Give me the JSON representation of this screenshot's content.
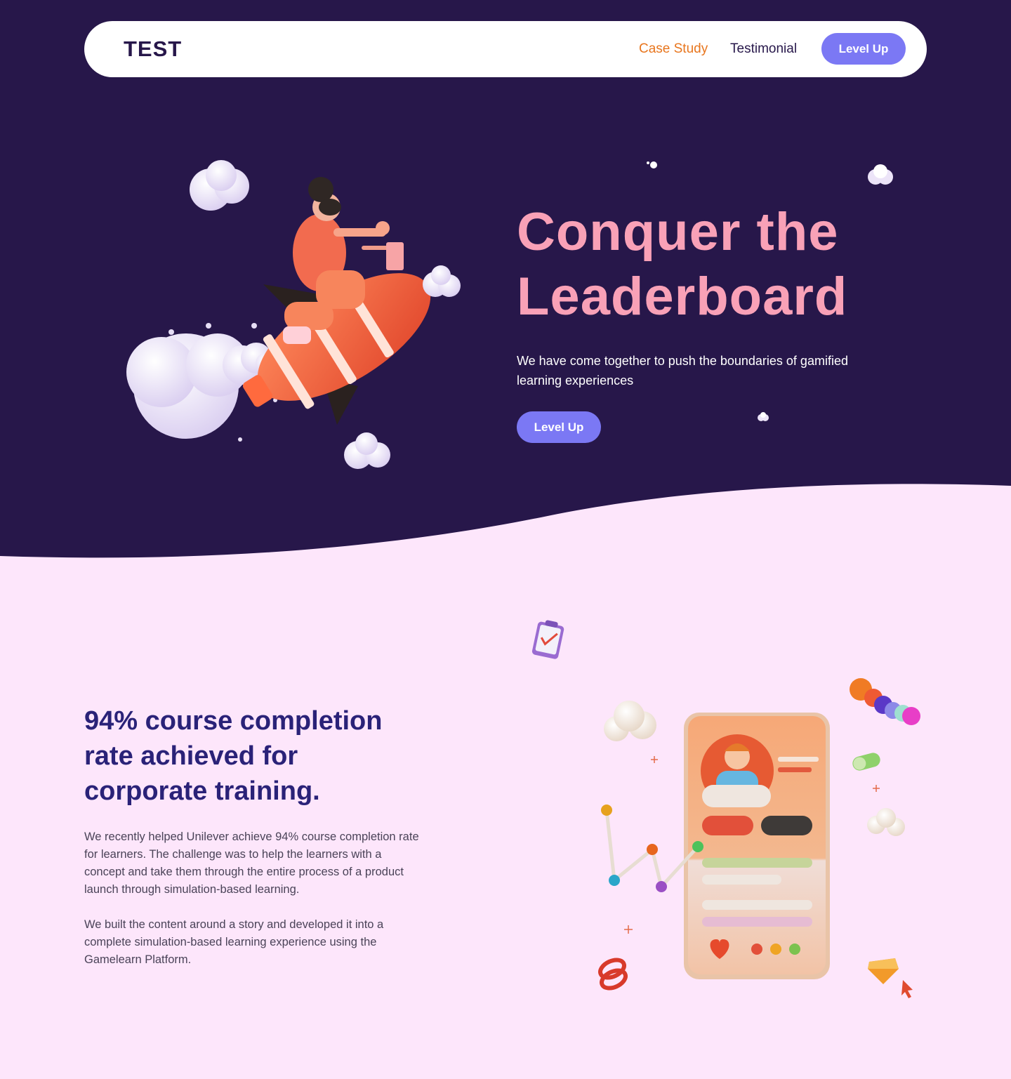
{
  "nav": {
    "logo": "TEST",
    "links": [
      {
        "label": "Case Study",
        "color": "#e8761e"
      },
      {
        "label": "Testimonial",
        "color": "#27174a"
      }
    ],
    "cta_label": "Level Up"
  },
  "hero": {
    "title": "Conquer the Leaderboard",
    "subtitle": "We have come together to push the boundaries of gamified learning experiences",
    "cta_label": "Level Up"
  },
  "case_study": {
    "title": "94% course completion rate achieved for corporate training.",
    "paragraphs": [
      "We recently helped Unilever achieve 94% course completion rate for learners.  The challenge was to help the learners with a concept and take them through the entire process of a product launch through simulation-based learning.",
      "We built the content around a story and developed it into a complete simulation-based learning experience using the Gamelearn Platform."
    ]
  },
  "colors": {
    "hero_bg": "#27174a",
    "page_bg": "#fde6fb",
    "accent_button": "#7b78f4",
    "hero_title": "#f9a1b7",
    "section_title": "#2a2278",
    "nav_active": "#e8761e"
  },
  "icons": [
    "rocket-rider-illustration",
    "cloud-icon",
    "phone-profile-illustration",
    "clipboard-icon",
    "diamond-icon",
    "cursor-icon",
    "swirl-icon",
    "pill-icon",
    "heart-icon"
  ]
}
